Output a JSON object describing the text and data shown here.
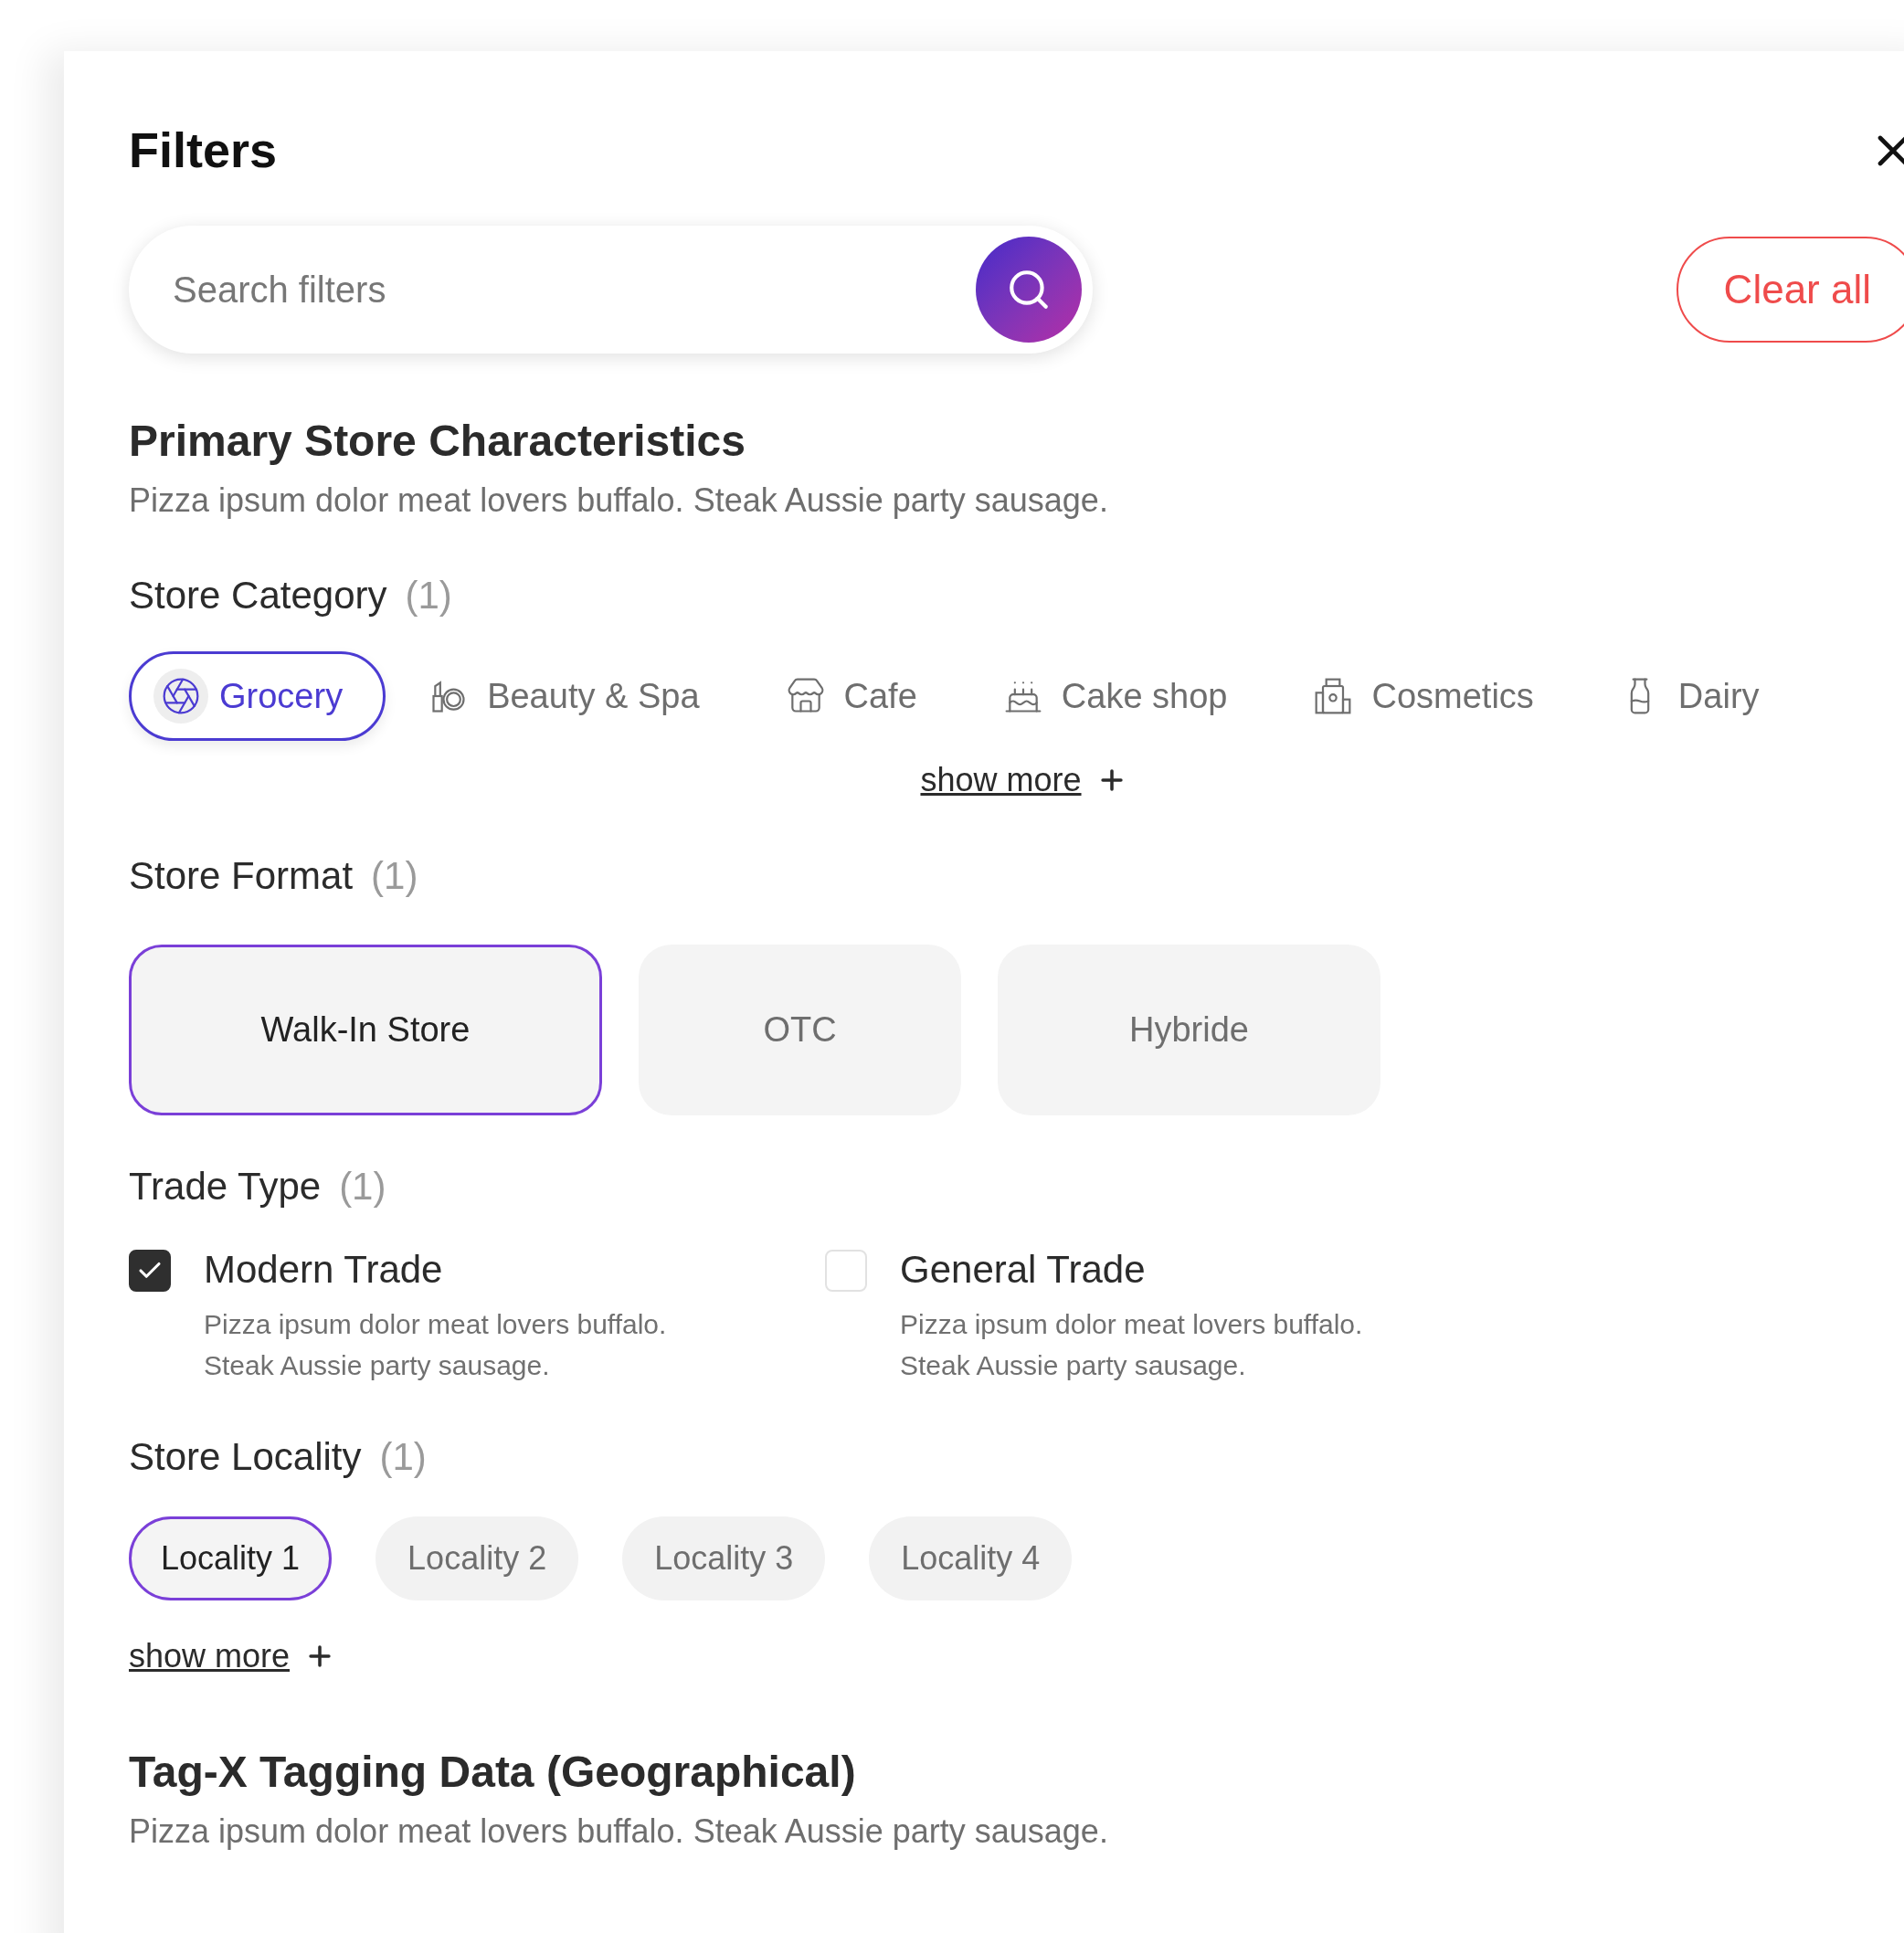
{
  "panel": {
    "title": "Filters"
  },
  "search": {
    "placeholder": "Search filters"
  },
  "clear_button": "Clear all",
  "sections": [
    {
      "title": "Primary Store Characteristics",
      "description": "Pizza ipsum dolor meat lovers buffalo. Steak Aussie party sausage.",
      "groups": [
        {
          "kind": "chips",
          "title": "Store Category",
          "count": "(1)",
          "show_more": "show more",
          "options": [
            {
              "label": "Grocery",
              "selected": true
            },
            {
              "label": "Beauty & Spa",
              "selected": false
            },
            {
              "label": "Cafe",
              "selected": false
            },
            {
              "label": "Cake shop",
              "selected": false
            },
            {
              "label": "Cosmetics",
              "selected": false
            },
            {
              "label": "Dairy",
              "selected": false
            }
          ]
        },
        {
          "kind": "tiles",
          "title": "Store Format",
          "count": "(1)",
          "options": [
            {
              "label": "Walk-In Store",
              "selected": true
            },
            {
              "label": "OTC",
              "selected": false
            },
            {
              "label": "Hybride",
              "selected": false
            }
          ]
        },
        {
          "kind": "checks",
          "title": "Trade Type",
          "count": "(1)",
          "options": [
            {
              "label": "Modern Trade",
              "checked": true,
              "description": "Pizza ipsum dolor meat lovers buffalo. Steak Aussie party sausage."
            },
            {
              "label": "General Trade",
              "checked": false,
              "description": "Pizza ipsum dolor meat lovers buffalo. Steak Aussie party sausage."
            }
          ]
        },
        {
          "kind": "pills",
          "title": "Store Locality",
          "count": "(1)",
          "show_more": "show more",
          "options": [
            {
              "label": "Locality 1",
              "selected": true
            },
            {
              "label": "Locality 2",
              "selected": false
            },
            {
              "label": "Locality 3",
              "selected": false
            },
            {
              "label": "Locality 4",
              "selected": false
            }
          ]
        }
      ]
    },
    {
      "title": "Tag-X Tagging Data (Geographical)",
      "description": "Pizza ipsum dolor meat lovers buffalo. Steak Aussie party sausage."
    }
  ]
}
